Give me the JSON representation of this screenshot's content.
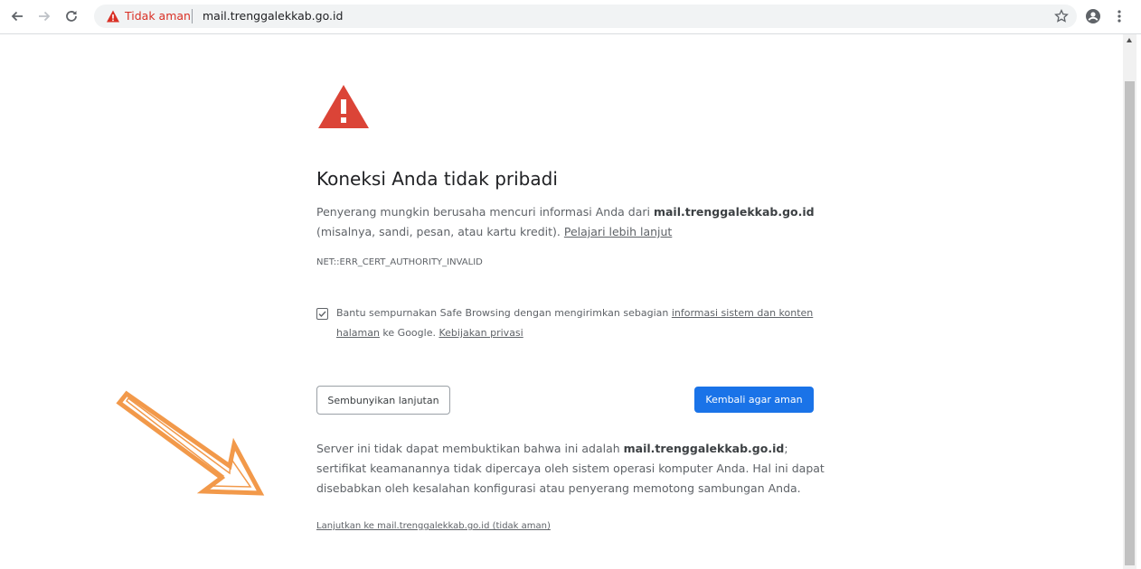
{
  "browser": {
    "security_status": "Tidak aman",
    "url": "mail.trenggalekkab.go.id"
  },
  "interstitial": {
    "title": "Koneksi Anda tidak pribadi",
    "message_part1": "Penyerang mungkin berusaha mencuri informasi Anda dari ",
    "message_domain": "mail.trenggalekkab.go.id",
    "message_part2": " (misalnya, sandi, pesan, atau kartu kredit). ",
    "learn_more": "Pelajari lebih lanjut",
    "error_code": "NET::ERR_CERT_AUTHORITY_INVALID",
    "safe_browsing": {
      "checked": true,
      "text1": "Bantu sempurnakan Safe Browsing dengan mengirimkan sebagian ",
      "link1": "informasi sistem dan konten halaman",
      "text2": " ke Google. ",
      "link2": "Kebijakan privasi"
    },
    "details_button": "Sembunyikan lanjutan",
    "primary_button": "Kembali agar aman",
    "details_part1": "Server ini tidak dapat membuktikan bahwa ini adalah ",
    "details_domain": "mail.trenggalekkab.go.id",
    "details_part2": "; sertifikat keamanannya tidak dipercaya oleh sistem operasi komputer Anda. Hal ini dapat disebabkan oleh kesalahan konfigurasi atau penyerang memotong sambungan Anda.",
    "proceed_link": "Lanjutkan ke mail.trenggalekkab.go.id (tidak aman)"
  },
  "icons": {
    "back": "back-arrow-icon",
    "forward": "forward-arrow-icon",
    "reload": "reload-icon",
    "warning": "warning-triangle-icon",
    "star": "star-icon",
    "account": "account-icon",
    "menu": "three-dot-menu-icon"
  },
  "colors": {
    "warning_red": "#d93025",
    "error_icon_red": "#db4437",
    "primary_blue": "#1a73e8",
    "annotation_orange": "#f2994a"
  }
}
